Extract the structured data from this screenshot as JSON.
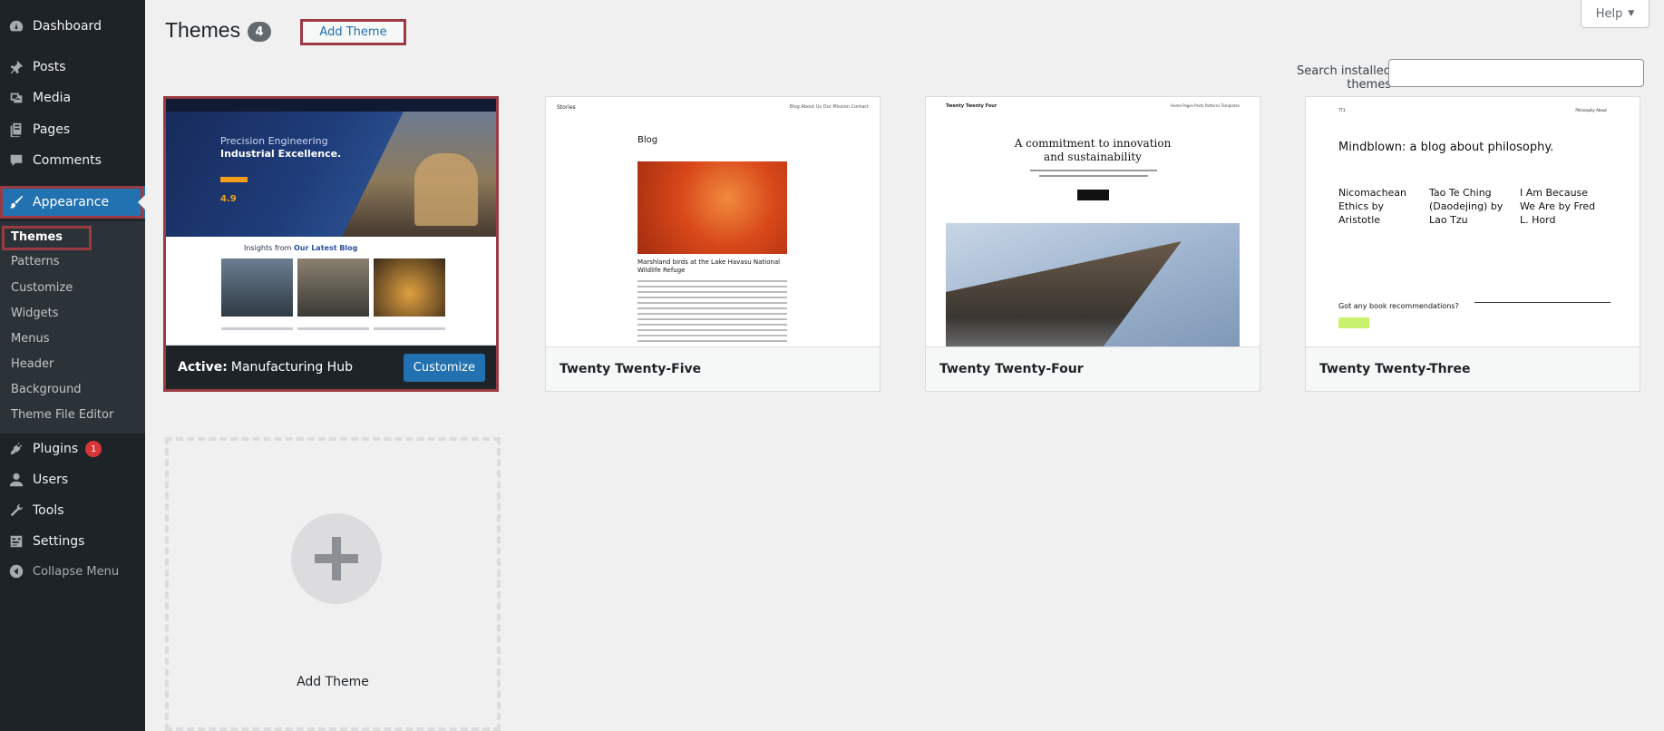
{
  "sidebar": {
    "items": [
      {
        "label": "Dashboard",
        "icon": "dashboard-icon"
      },
      {
        "label": "Posts",
        "icon": "pin-icon"
      },
      {
        "label": "Media",
        "icon": "media-icon"
      },
      {
        "label": "Pages",
        "icon": "pages-icon"
      },
      {
        "label": "Comments",
        "icon": "comment-icon"
      },
      {
        "label": "Appearance",
        "icon": "brush-icon"
      },
      {
        "label": "Plugins",
        "icon": "plugin-icon",
        "badge": "1"
      },
      {
        "label": "Users",
        "icon": "user-icon"
      },
      {
        "label": "Tools",
        "icon": "wrench-icon"
      },
      {
        "label": "Settings",
        "icon": "settings-icon"
      },
      {
        "label": "Collapse Menu",
        "icon": "collapse-icon"
      }
    ],
    "submenu": [
      "Themes",
      "Patterns",
      "Customize",
      "Widgets",
      "Menus",
      "Header",
      "Background",
      "Theme File Editor"
    ]
  },
  "header": {
    "title": "Themes",
    "count": "4",
    "add_theme": "Add Theme",
    "help": "Help"
  },
  "search": {
    "label": "Search installed themes",
    "value": ""
  },
  "themes": [
    {
      "name": "Manufacturing Hub",
      "active_prefix": "Active:",
      "customize": "Customize",
      "preview": {
        "hero_line1": "Precision Engineering",
        "hero_line2": "Industrial Excellence.",
        "rating": "4.9",
        "blog_prefix": "Insights from ",
        "blog_highlight": "Our Latest Blog"
      }
    },
    {
      "name": "Twenty Twenty-Five",
      "preview": {
        "site": "Stories",
        "nav": "Blog   About Us   Our Mission   Contact",
        "heading": "Blog",
        "caption": "Marshland birds at the Lake Havasu National Wildlife Refuge"
      }
    },
    {
      "name": "Twenty Twenty-Four",
      "preview": {
        "site": "Twenty Twenty Four",
        "nav": "Home   Pages   Posts   Patterns   Templates",
        "heading_line1": "A commitment to innovation",
        "heading_line2": "and sustainability"
      }
    },
    {
      "name": "Twenty Twenty-Three",
      "preview": {
        "site": "TT3",
        "nav": "Philosophy   About",
        "heading": "Mindblown: a blog about philosophy.",
        "posts": [
          "Nicomachean Ethics by Aristotle",
          "Tao Te Ching (Daodejing) by Lao Tzu",
          "I Am Because We Are by Fred L. Hord"
        ],
        "question": "Got any book recommendations?"
      }
    }
  ],
  "add_new": {
    "label": "Add Theme"
  }
}
